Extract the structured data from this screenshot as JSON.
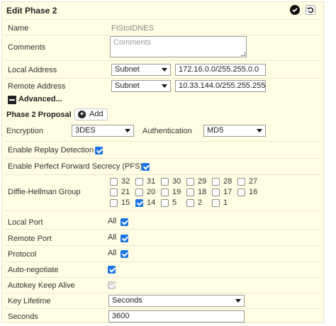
{
  "header": {
    "title": "Edit Phase 2",
    "confirm_icon": "check-circle-icon",
    "revert_icon": "undo-icon"
  },
  "fields": {
    "name": {
      "label": "Name",
      "value": "FIStoIDNES"
    },
    "comments": {
      "label": "Comments",
      "placeholder": "Comments"
    },
    "local_address": {
      "label": "Local Address",
      "type": "Subnet",
      "value": "172.16.0.0/255.255.0.0"
    },
    "remote_address": {
      "label": "Remote Address",
      "type": "Subnet",
      "value": "10.33.144.0/255.255.255"
    }
  },
  "advanced": {
    "label": "Advanced...",
    "icon": "collapse-minus-icon"
  },
  "proposal": {
    "label": "Phase 2 Proposal",
    "add_label": "Add",
    "encryption_label": "Encryption",
    "encryption_value": "3DES",
    "authentication_label": "Authentication",
    "authentication_value": "MD5"
  },
  "replay": {
    "label": "Enable Replay Detection",
    "checked": true
  },
  "pfs": {
    "label": "Enable Perfect Forward Secrecy (PFS)",
    "checked": true
  },
  "dh": {
    "label": "Diffie-Hellman Group",
    "rows": [
      [
        {
          "n": "32",
          "on": false
        },
        {
          "n": "31",
          "on": false
        },
        {
          "n": "30",
          "on": false
        },
        {
          "n": "29",
          "on": false
        },
        {
          "n": "28",
          "on": false
        },
        {
          "n": "27",
          "on": false
        }
      ],
      [
        {
          "n": "21",
          "on": false
        },
        {
          "n": "20",
          "on": false
        },
        {
          "n": "19",
          "on": false
        },
        {
          "n": "18",
          "on": false
        },
        {
          "n": "17",
          "on": false
        },
        {
          "n": "16",
          "on": false
        }
      ],
      [
        {
          "n": "15",
          "on": false
        },
        {
          "n": "14",
          "on": true
        },
        {
          "n": "5",
          "on": false
        },
        {
          "n": "2",
          "on": false
        },
        {
          "n": "1",
          "on": false
        }
      ]
    ]
  },
  "ports": {
    "local": {
      "label": "Local Port",
      "value": "All",
      "checked": true
    },
    "remote": {
      "label": "Remote Port",
      "value": "All",
      "checked": true
    },
    "protocol": {
      "label": "Protocol",
      "value": "All",
      "checked": true
    }
  },
  "auto_negotiate": {
    "label": "Auto-negotiate",
    "checked": true
  },
  "keepalive": {
    "label": "Autokey Keep Alive",
    "checked": true,
    "disabled": true
  },
  "key_lifetime": {
    "label": "Key Lifetime",
    "value": "Seconds"
  },
  "seconds": {
    "label": "Seconds",
    "value": "3600"
  },
  "colors": {
    "panel_bg": "#fffde3",
    "accent": "#1a73e8"
  }
}
